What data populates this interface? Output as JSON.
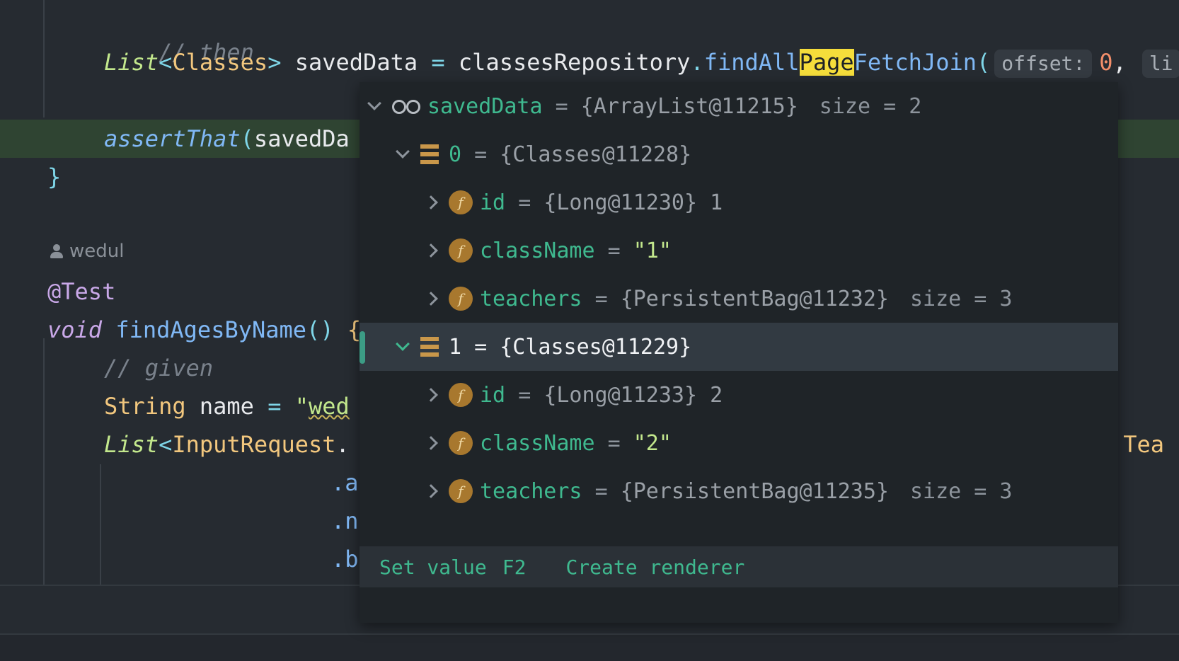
{
  "editor": {
    "lines": {
      "comment_then": "// then",
      "saved_type": "List",
      "saved_lt": "<",
      "saved_generic": "Classes",
      "saved_gt": ">",
      "saved_var": "savedData",
      "saved_eq": " = ",
      "saved_repo": "classesRepository",
      "saved_dot": ".",
      "saved_fn_a": "findAll",
      "saved_fn_hit": "Page",
      "saved_fn_b": "FetchJoin",
      "saved_paren": "(",
      "hint_offset": "offset:",
      "offset_value": "0",
      "comma": ",",
      "hint_limit_partial": "li",
      "assert_fn": "assertThat",
      "assert_paren": "(",
      "assert_arg": "savedDa",
      "close_brace": "}",
      "annotation": "@Test",
      "void_kw": "void",
      "method_name": "findAgesByName",
      "method_parens": "()",
      "method_brace": " {",
      "comment_given": "// given",
      "string_type": "String",
      "name_var": "name",
      "name_eq": " = ",
      "name_str_quote": "\"",
      "name_str_partial": "wed",
      "input_list_type": "List",
      "input_lt": "<",
      "input_generic": "InputRequest",
      "input_dot": ".",
      "right_partial": ".Tea",
      "chain_a": ".a",
      "chain_n": ".n",
      "chain_b": ".b"
    },
    "author": "wedul"
  },
  "debug_popup": {
    "root": {
      "name": "savedData",
      "eq": "=",
      "value": "{ArrayList@11215}",
      "size": "size = 2"
    },
    "items": [
      {
        "index": "0",
        "eq": "=",
        "value": "{Classes@11228}",
        "fields": [
          {
            "name": "id",
            "eq": "=",
            "value": "{Long@11230} 1"
          },
          {
            "name": "className",
            "eq": "=",
            "value": "\"1\""
          },
          {
            "name": "teachers",
            "eq": "=",
            "value": "{PersistentBag@11232}",
            "size": "size = 3"
          }
        ]
      },
      {
        "index": "1",
        "eq": "=",
        "value": "{Classes@11229}",
        "fields": [
          {
            "name": "id",
            "eq": "=",
            "value": "{Long@11233} 2"
          },
          {
            "name": "className",
            "eq": "=",
            "value": "\"2\""
          },
          {
            "name": "teachers",
            "eq": "=",
            "value": "{PersistentBag@11235}",
            "size": "size = 3"
          }
        ]
      }
    ],
    "field_icon_letter": "f",
    "footer": {
      "set_value": "Set value",
      "set_value_key": "F2",
      "create_renderer": "Create renderer"
    }
  }
}
